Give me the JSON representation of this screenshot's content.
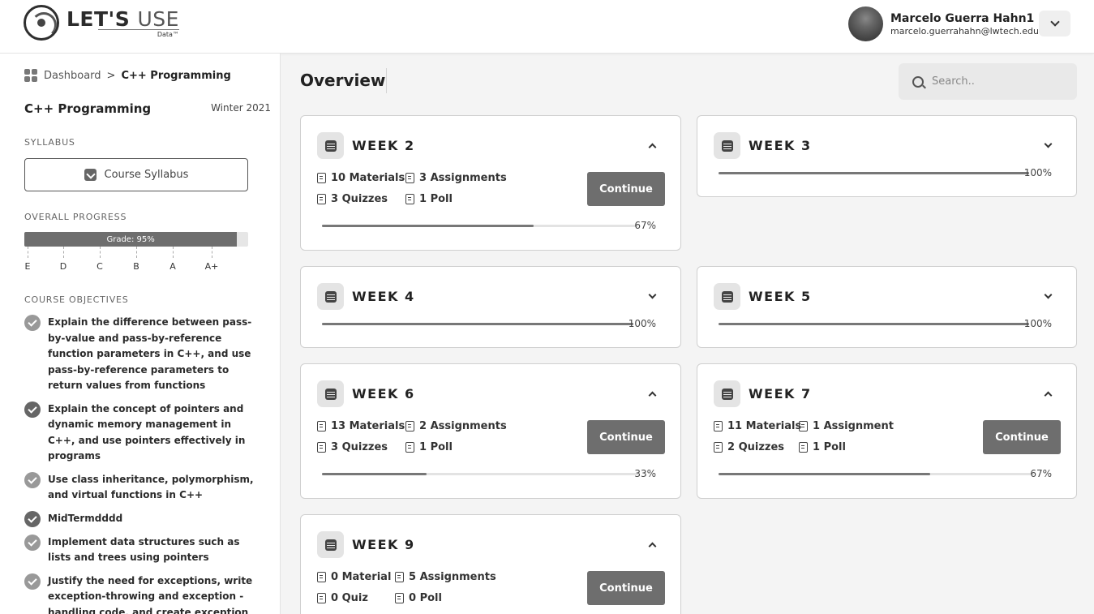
{
  "header": {
    "logo_text": "LET'S",
    "logo_text_light": "USE",
    "logo_sub": "Data™",
    "user_name": "Marcelo Guerra Hahn1",
    "user_email": "marcelo.guerrahahn@lwtech.edu"
  },
  "sidebar": {
    "breadcrumb_root": "Dashboard",
    "breadcrumb_sep": ">",
    "breadcrumb_current": "C++ Programming",
    "course_title": "C++ Programming",
    "course_term": "Winter 2021",
    "syllabus_label": "SYLLABUS",
    "syllabus_button": "Course Syllabus",
    "progress_label": "OVERALL PROGRESS",
    "grade_text": "Grade: 95%",
    "grade_value": 95,
    "grade_scale": [
      "E",
      "D",
      "C",
      "B",
      "A",
      "A+"
    ],
    "objectives_label": "COURSE OBJECTIVES",
    "objectives": [
      "Explain the difference between pass-by-value and pass-by-reference function parameters in C++, and use pass-by-reference parameters to return values from functions",
      "Explain the concept of pointers and dynamic memory management in C++, and use pointers effectively in programs",
      "Use class inheritance, polymorphism, and virtual functions in C++",
      "MidTermdddd",
      "Implement data structures such as lists and trees using pointers",
      "Justify the need for exceptions, write exception-throwing and exception - handling code, and create exception classes"
    ]
  },
  "main": {
    "title": "Overview",
    "search_placeholder": "Search..",
    "continue_label": "Continue",
    "weeks": [
      {
        "title": "WEEK 2",
        "expanded": true,
        "materials": "10 Materials",
        "assignments": "3 Assignments",
        "quizzes": "3 Quizzes",
        "poll": "1 Poll",
        "progress": 67,
        "progress_text": "67%"
      },
      {
        "title": "WEEK 3",
        "expanded": false,
        "progress": 100,
        "progress_text": "100%"
      },
      {
        "title": "WEEK 4",
        "expanded": false,
        "progress": 100,
        "progress_text": "100%"
      },
      {
        "title": "WEEK 5",
        "expanded": false,
        "progress": 100,
        "progress_text": "100%"
      },
      {
        "title": "WEEK 6",
        "expanded": true,
        "materials": "13 Materials",
        "assignments": "2 Assignments",
        "quizzes": "3 Quizzes",
        "poll": "1 Poll",
        "progress": 33,
        "progress_text": "33%"
      },
      {
        "title": "WEEK 7",
        "expanded": true,
        "materials": "11 Materials",
        "assignments": "1 Assignment",
        "quizzes": "2 Quizzes",
        "poll": "1 Poll",
        "progress": 67,
        "progress_text": "67%"
      },
      {
        "title": "WEEK 9",
        "expanded": true,
        "materials": "0 Material",
        "assignments": "5 Assignments",
        "quizzes": "0 Quiz",
        "poll": "0 Poll"
      }
    ]
  }
}
